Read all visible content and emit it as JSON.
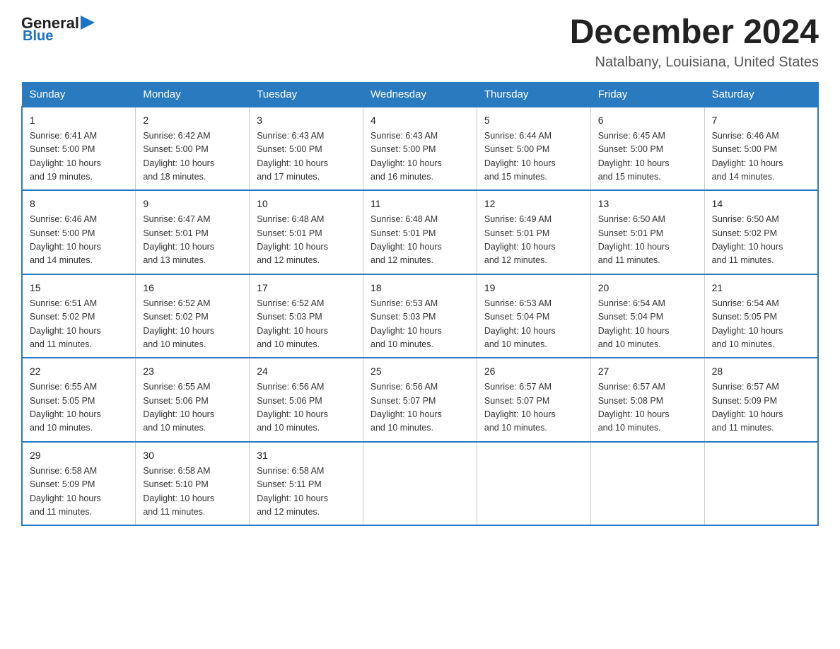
{
  "header": {
    "logo_general": "General",
    "logo_blue": "Blue",
    "month_title": "December 2024",
    "location": "Natalbany, Louisiana, United States"
  },
  "weekdays": [
    "Sunday",
    "Monday",
    "Tuesday",
    "Wednesday",
    "Thursday",
    "Friday",
    "Saturday"
  ],
  "rows": [
    [
      {
        "day": "1",
        "sunrise": "6:41 AM",
        "sunset": "5:00 PM",
        "daylight": "10 hours and 19 minutes."
      },
      {
        "day": "2",
        "sunrise": "6:42 AM",
        "sunset": "5:00 PM",
        "daylight": "10 hours and 18 minutes."
      },
      {
        "day": "3",
        "sunrise": "6:43 AM",
        "sunset": "5:00 PM",
        "daylight": "10 hours and 17 minutes."
      },
      {
        "day": "4",
        "sunrise": "6:43 AM",
        "sunset": "5:00 PM",
        "daylight": "10 hours and 16 minutes."
      },
      {
        "day": "5",
        "sunrise": "6:44 AM",
        "sunset": "5:00 PM",
        "daylight": "10 hours and 15 minutes."
      },
      {
        "day": "6",
        "sunrise": "6:45 AM",
        "sunset": "5:00 PM",
        "daylight": "10 hours and 15 minutes."
      },
      {
        "day": "7",
        "sunrise": "6:46 AM",
        "sunset": "5:00 PM",
        "daylight": "10 hours and 14 minutes."
      }
    ],
    [
      {
        "day": "8",
        "sunrise": "6:46 AM",
        "sunset": "5:00 PM",
        "daylight": "10 hours and 14 minutes."
      },
      {
        "day": "9",
        "sunrise": "6:47 AM",
        "sunset": "5:01 PM",
        "daylight": "10 hours and 13 minutes."
      },
      {
        "day": "10",
        "sunrise": "6:48 AM",
        "sunset": "5:01 PM",
        "daylight": "10 hours and 12 minutes."
      },
      {
        "day": "11",
        "sunrise": "6:48 AM",
        "sunset": "5:01 PM",
        "daylight": "10 hours and 12 minutes."
      },
      {
        "day": "12",
        "sunrise": "6:49 AM",
        "sunset": "5:01 PM",
        "daylight": "10 hours and 12 minutes."
      },
      {
        "day": "13",
        "sunrise": "6:50 AM",
        "sunset": "5:01 PM",
        "daylight": "10 hours and 11 minutes."
      },
      {
        "day": "14",
        "sunrise": "6:50 AM",
        "sunset": "5:02 PM",
        "daylight": "10 hours and 11 minutes."
      }
    ],
    [
      {
        "day": "15",
        "sunrise": "6:51 AM",
        "sunset": "5:02 PM",
        "daylight": "10 hours and 11 minutes."
      },
      {
        "day": "16",
        "sunrise": "6:52 AM",
        "sunset": "5:02 PM",
        "daylight": "10 hours and 10 minutes."
      },
      {
        "day": "17",
        "sunrise": "6:52 AM",
        "sunset": "5:03 PM",
        "daylight": "10 hours and 10 minutes."
      },
      {
        "day": "18",
        "sunrise": "6:53 AM",
        "sunset": "5:03 PM",
        "daylight": "10 hours and 10 minutes."
      },
      {
        "day": "19",
        "sunrise": "6:53 AM",
        "sunset": "5:04 PM",
        "daylight": "10 hours and 10 minutes."
      },
      {
        "day": "20",
        "sunrise": "6:54 AM",
        "sunset": "5:04 PM",
        "daylight": "10 hours and 10 minutes."
      },
      {
        "day": "21",
        "sunrise": "6:54 AM",
        "sunset": "5:05 PM",
        "daylight": "10 hours and 10 minutes."
      }
    ],
    [
      {
        "day": "22",
        "sunrise": "6:55 AM",
        "sunset": "5:05 PM",
        "daylight": "10 hours and 10 minutes."
      },
      {
        "day": "23",
        "sunrise": "6:55 AM",
        "sunset": "5:06 PM",
        "daylight": "10 hours and 10 minutes."
      },
      {
        "day": "24",
        "sunrise": "6:56 AM",
        "sunset": "5:06 PM",
        "daylight": "10 hours and 10 minutes."
      },
      {
        "day": "25",
        "sunrise": "6:56 AM",
        "sunset": "5:07 PM",
        "daylight": "10 hours and 10 minutes."
      },
      {
        "day": "26",
        "sunrise": "6:57 AM",
        "sunset": "5:07 PM",
        "daylight": "10 hours and 10 minutes."
      },
      {
        "day": "27",
        "sunrise": "6:57 AM",
        "sunset": "5:08 PM",
        "daylight": "10 hours and 10 minutes."
      },
      {
        "day": "28",
        "sunrise": "6:57 AM",
        "sunset": "5:09 PM",
        "daylight": "10 hours and 11 minutes."
      }
    ],
    [
      {
        "day": "29",
        "sunrise": "6:58 AM",
        "sunset": "5:09 PM",
        "daylight": "10 hours and 11 minutes."
      },
      {
        "day": "30",
        "sunrise": "6:58 AM",
        "sunset": "5:10 PM",
        "daylight": "10 hours and 11 minutes."
      },
      {
        "day": "31",
        "sunrise": "6:58 AM",
        "sunset": "5:11 PM",
        "daylight": "10 hours and 12 minutes."
      },
      null,
      null,
      null,
      null
    ]
  ],
  "labels": {
    "sunrise_prefix": "Sunrise: ",
    "sunset_prefix": "Sunset: ",
    "daylight_prefix": "Daylight: "
  }
}
